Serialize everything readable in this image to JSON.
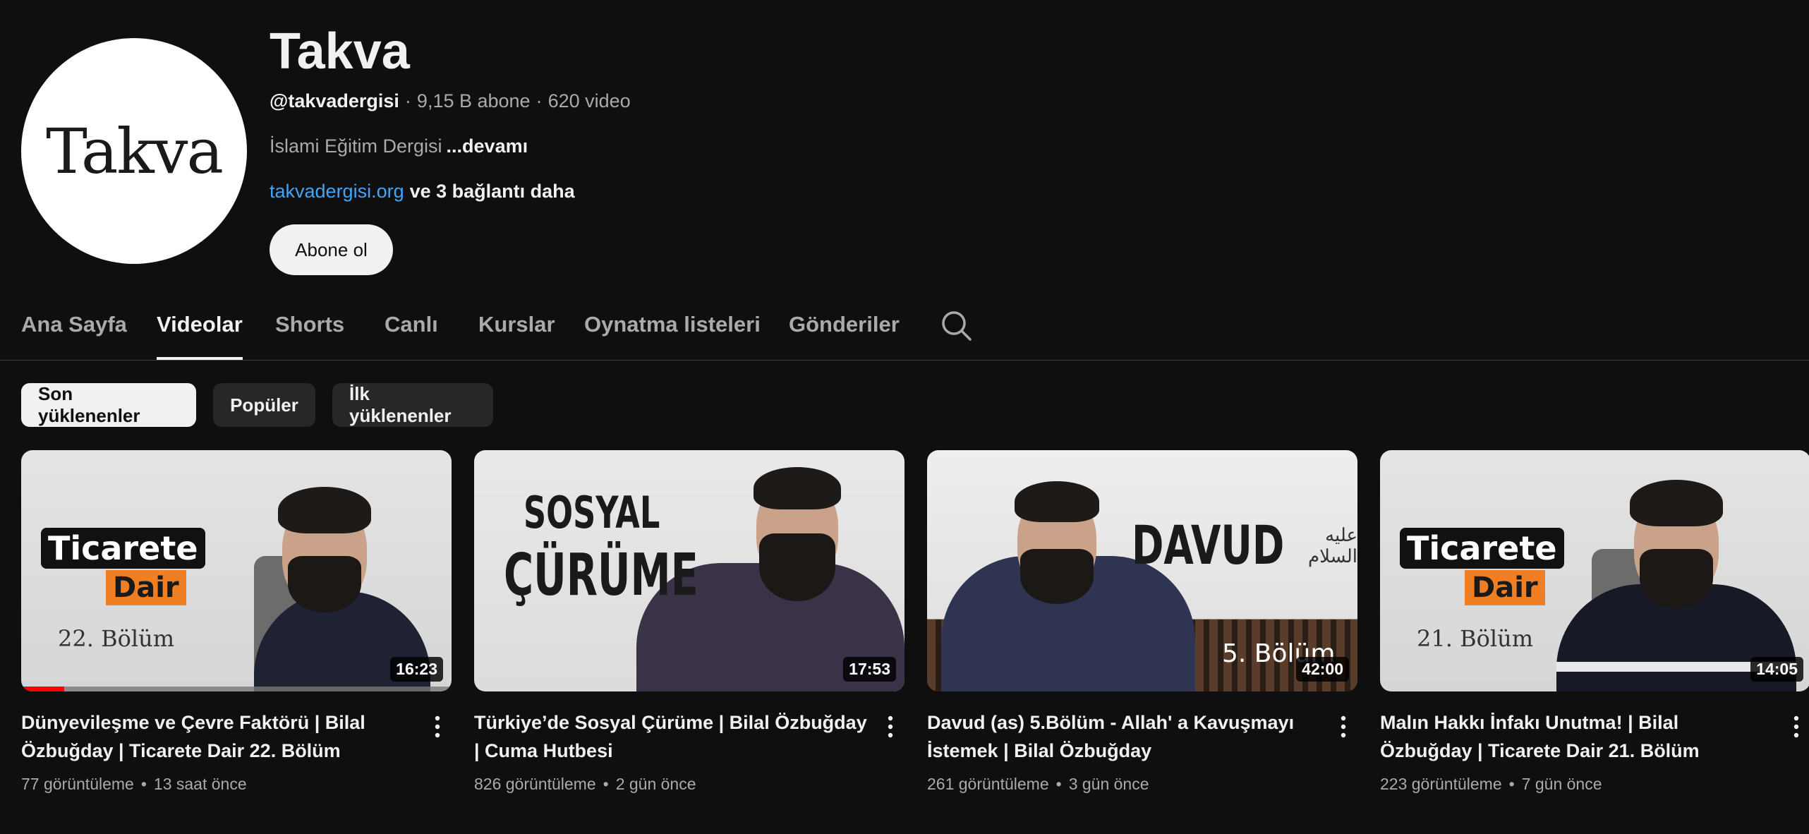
{
  "channel": {
    "avatar_text": "Takva",
    "title": "Takva",
    "handle": "@takvadergisi",
    "subscribers": "9,15 B abone",
    "video_count": "620 video",
    "description": "İslami Eğitim Dergisi",
    "description_more": "...devamı",
    "link": "takvadergisi.org",
    "more_links": "ve 3 bağlantı daha",
    "subscribe_label": "Abone ol"
  },
  "tabs": [
    {
      "label": "Ana Sayfa"
    },
    {
      "label": "Videolar",
      "active": true
    },
    {
      "label": "Shorts"
    },
    {
      "label": "Canlı"
    },
    {
      "label": "Kurslar"
    },
    {
      "label": "Oynatma listeleri"
    },
    {
      "label": "Gönderiler"
    }
  ],
  "chips": [
    {
      "label": "Son yüklenenler",
      "selected": true
    },
    {
      "label": "Popüler"
    },
    {
      "label": "İlk yüklenenler"
    }
  ],
  "videos": [
    {
      "title": "Dünyevileşme ve Çevre Faktörü | Bilal Özbuğday | Ticarete Dair 22. Bölüm",
      "views": "77 görüntüleme",
      "age": "13 saat önce",
      "duration": "16:23",
      "watched_fraction": 0.1,
      "thumb_text": [
        "Ticarete",
        "Dair",
        "22. Bölüm"
      ]
    },
    {
      "title": "Türkiye’de Sosyal Çürüme | Bilal Özbuğday | Cuma Hutbesi",
      "views": "826 görüntüleme",
      "age": "2 gün önce",
      "duration": "17:53",
      "thumb_text": [
        "SOSYAL",
        "ÇÜRÜME"
      ]
    },
    {
      "title": "Davud (as) 5.Bölüm - Allah' a Kavuşmayı İstemek | Bilal Özbuğday",
      "views": "261 görüntüleme",
      "age": "3 gün önce",
      "duration": "42:00",
      "thumb_text": [
        "DAVUD",
        "عليه السلام",
        "5. Bölüm"
      ]
    },
    {
      "title": "Malın Hakkı İnfakı Unutma! | Bilal Özbuğday | Ticarete Dair 21. Bölüm",
      "views": "223 görüntüleme",
      "age": "7 gün önce",
      "duration": "14:05",
      "thumb_text": [
        "Ticarete",
        "Dair",
        "21. Bölüm"
      ]
    }
  ],
  "colors": {
    "background": "#0f0f0f",
    "link": "#3ea6ff",
    "progress": "#ff0000",
    "badge_orange": "#f07e22"
  },
  "icons": {
    "search": "search-icon",
    "menu": "more-vert-icon"
  }
}
